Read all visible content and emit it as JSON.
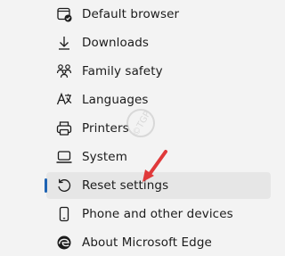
{
  "settings_nav": {
    "items": [
      {
        "label": "Default browser",
        "icon": "default-browser-icon"
      },
      {
        "label": "Downloads",
        "icon": "download-icon"
      },
      {
        "label": "Family safety",
        "icon": "family-icon"
      },
      {
        "label": "Languages",
        "icon": "language-icon"
      },
      {
        "label": "Printers",
        "icon": "printer-icon"
      },
      {
        "label": "System",
        "icon": "laptop-icon"
      },
      {
        "label": "Reset settings",
        "icon": "reset-icon",
        "selected": true
      },
      {
        "label": "Phone and other devices",
        "icon": "phone-icon"
      },
      {
        "label": "About Microsoft Edge",
        "icon": "edge-logo-icon"
      }
    ]
  },
  "watermark": {
    "text": "©TGP"
  },
  "colors": {
    "background": "#f3f3f3",
    "selected_background": "#e6e6e6",
    "accent_indicator": "#1e63b3",
    "annotation_arrow": "#e0393a",
    "text": "#1b1b1b"
  }
}
